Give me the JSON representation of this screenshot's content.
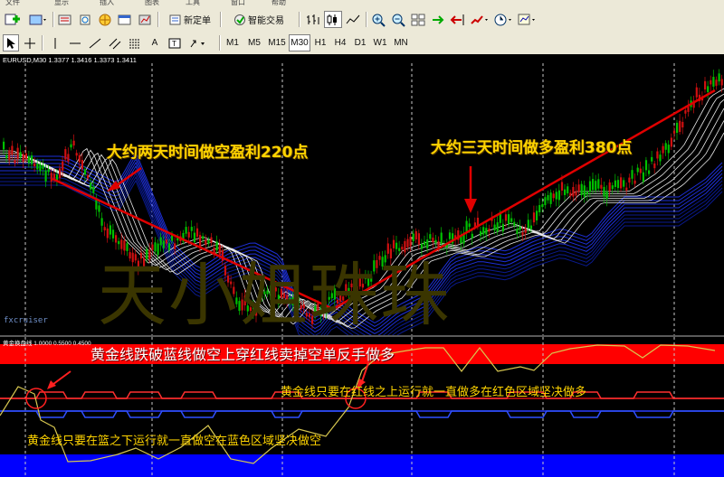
{
  "menu": [
    "文件",
    "显示",
    "插入",
    "图表",
    "工具",
    "窗口",
    "帮助"
  ],
  "toolbar1": {
    "new_order_label": "新定单",
    "expert_label": "智能交易"
  },
  "toolbar2": {
    "timeframes": [
      "M1",
      "M5",
      "M15",
      "M30",
      "H1",
      "H4",
      "D1",
      "W1",
      "MN"
    ],
    "active_timeframe": "M30",
    "text_tool": "A"
  },
  "chart": {
    "header": "EURUSD,M30  1.3377  1.3416  1.3373  1.3411",
    "annotation_short": "大约两天时间做空盈利220点",
    "annotation_long": "大约三天时间做多盈利380点",
    "watermark": "天小姐珠珠",
    "indicator_name": "fxcruiser"
  },
  "indicator": {
    "header": "黄金换盘线  1.0000  0.5500  0.4500",
    "text_top": "黄金线跌破蓝线做空上穿红线卖掉空单反手做多",
    "text_middle": "黄金线只要在红线之上运行就一直做多在红色区域坚决做多",
    "text_bottom": "黄金线只要在篮之下运行就一直做空在蓝色区域坚决做空"
  },
  "colors": {
    "red_zone": "#ff0000",
    "blue_zone": "#0000ff",
    "gold_line": "#d8c850",
    "candle_up": "#00c000",
    "candle_down": "#d01010",
    "trend_arrow": "#e00000"
  }
}
